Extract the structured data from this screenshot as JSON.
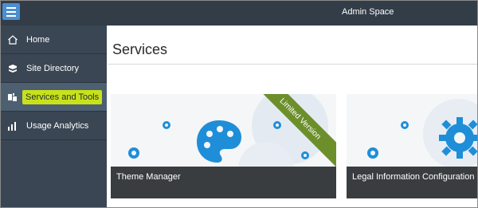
{
  "header": {
    "title": "Admin Space",
    "menu_icon": "hamburger-icon",
    "background": "#323d48",
    "menu_button_color": "#4c8fd1"
  },
  "sidebar": {
    "background": "#3a4653",
    "items": [
      {
        "label": "Home",
        "icon": "home-icon",
        "active": false
      },
      {
        "label": "Site Directory",
        "icon": "site-directory-icon",
        "active": false
      },
      {
        "label": "Services and Tools",
        "icon": "services-tools-icon",
        "active": true,
        "highlight_color": "#c8e21a"
      },
      {
        "label": "Usage Analytics",
        "icon": "bar-chart-icon",
        "active": false
      }
    ]
  },
  "main": {
    "title": "Services",
    "cards": [
      {
        "title": "Theme Manager",
        "icon": "palette-icon",
        "ribbon": "Limited Version",
        "ribbon_color": "#6c8f2c"
      },
      {
        "title": "Legal Information Configuration",
        "icon": "gear-icon"
      }
    ],
    "accent_color": "#1f8ed8"
  }
}
